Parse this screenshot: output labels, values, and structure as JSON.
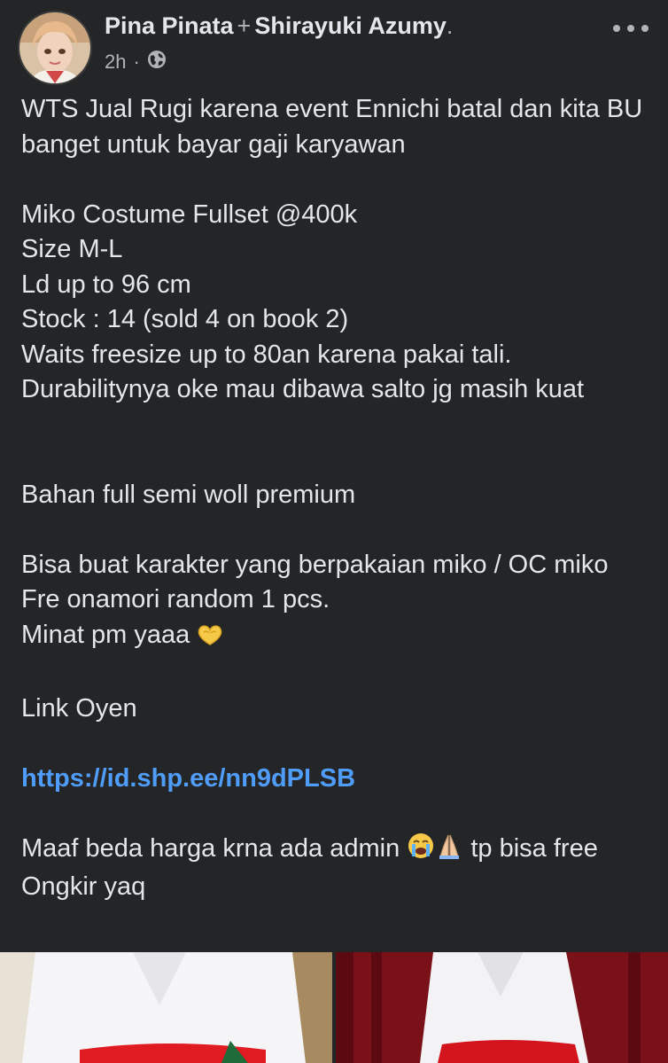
{
  "post": {
    "author": "Pina Pinata",
    "connector": "+",
    "page_name": "Shirayuki Azumy",
    "page_suffix": ".",
    "timestamp": "2h",
    "separator": "·",
    "lines": {
      "l1": "WTS Jual Rugi karena event Ennichi batal dan kita BU banget untuk bayar gaji karyawan",
      "l2": "Miko Costume Fullset @400k",
      "l3": "Size M-L",
      "l4": "Ld up to 96 cm",
      "l5": "Stock : 14 (sold 4 on book 2)",
      "l6": "Waits freesize up to 80an karena pakai tali.",
      "l7": "Durabilitynya oke mau dibawa salto jg masih kuat",
      "l8": "Bahan full semi woll premium",
      "l9": "Bisa buat karakter yang berpakaian miko / OC miko",
      "l10": "Fre onamori random 1 pcs.",
      "l11": "Minat pm yaaa",
      "l12": "Link Oyen",
      "link": "https://id.shp.ee/nn9dPLSB",
      "l13a": "Maaf beda harga krna ada admin",
      "l13b": "tp bisa free Ongkir yaq"
    }
  },
  "icons": {
    "privacy": "globe-icon",
    "more": "more-options-icon",
    "heart_hands": "heart-hands-emoji",
    "crying": "crying-face-emoji",
    "praying": "folded-hands-emoji"
  },
  "colors": {
    "background": "#242526",
    "text": "#e4e6eb",
    "secondary_text": "#b0b3b8",
    "link": "#4f9cf9"
  }
}
